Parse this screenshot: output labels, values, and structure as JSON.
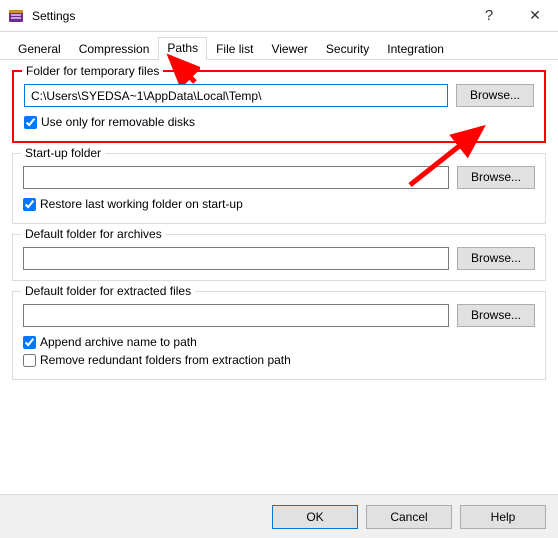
{
  "titlebar": {
    "title": "Settings",
    "help_glyph": "?",
    "close_glyph": "✕"
  },
  "tabs": [
    {
      "label": "General"
    },
    {
      "label": "Compression"
    },
    {
      "label": "Paths",
      "active": true
    },
    {
      "label": "File list"
    },
    {
      "label": "Viewer"
    },
    {
      "label": "Security"
    },
    {
      "label": "Integration"
    }
  ],
  "groups": {
    "temp": {
      "legend": "Folder for temporary files",
      "path": "C:\\Users\\SYEDSA~1\\AppData\\Local\\Temp\\",
      "browse": "Browse...",
      "check_label": "Use only for removable disks",
      "check_value": true
    },
    "startup": {
      "legend": "Start-up folder",
      "path": "",
      "browse": "Browse...",
      "check_label": "Restore last working folder on start-up",
      "check_value": true
    },
    "archives": {
      "legend": "Default folder for archives",
      "path": "",
      "browse": "Browse..."
    },
    "extracted": {
      "legend": "Default folder for extracted files",
      "path": "",
      "browse": "Browse...",
      "check1_label": "Append archive name to path",
      "check1_value": true,
      "check2_label": "Remove redundant folders from extraction path",
      "check2_value": false
    }
  },
  "footer": {
    "ok": "OK",
    "cancel": "Cancel",
    "help": "Help"
  }
}
